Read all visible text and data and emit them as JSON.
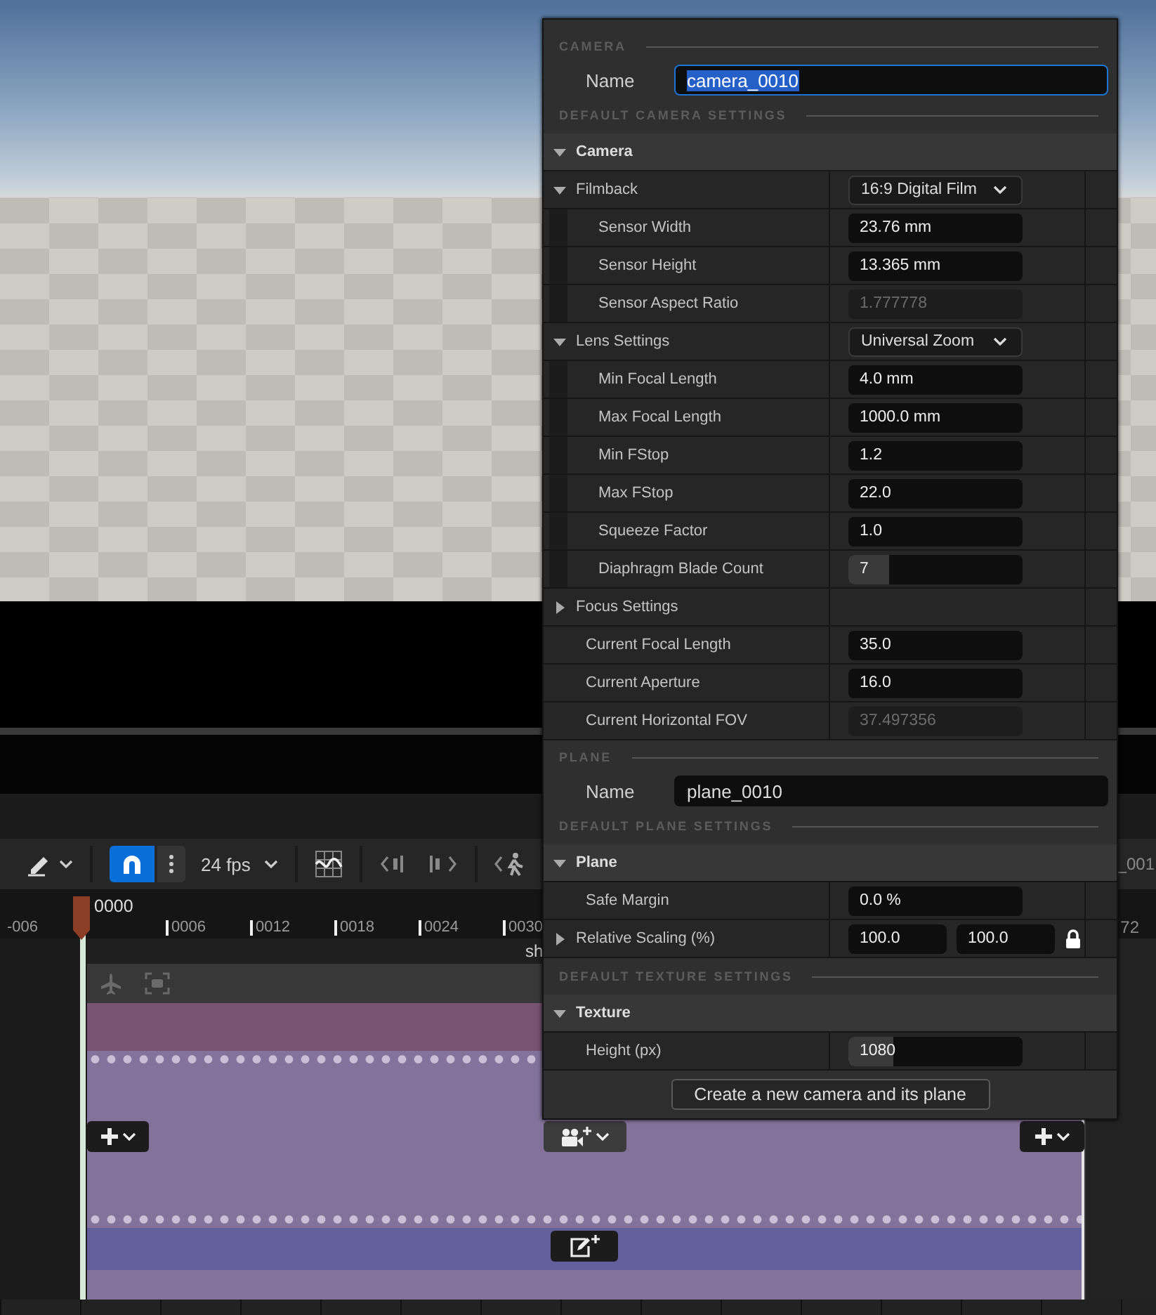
{
  "toolbar": {
    "snap_on": true,
    "frame_rate": "24 fps",
    "cut_label": "_001"
  },
  "ruler": {
    "playhead_time": "0000",
    "ticks": [
      "-006",
      "0006",
      "0012",
      "0018",
      "0024",
      "0030"
    ],
    "cut_label": "72"
  },
  "track": {
    "cut_label": "sh"
  },
  "panel": {
    "groups": [
      {
        "heading": "CAMERA",
        "name_field": {
          "label": "Name",
          "value": "camera_0010",
          "focused": true
        },
        "settings_heading": "DEFAULT CAMERA SETTINGS",
        "category": {
          "title": "Camera",
          "expanded": true,
          "properties": [
            {
              "label": "Filmback",
              "kind": "dropdown",
              "value": "16:9 Digital Film",
              "expanded": true,
              "children": [
                {
                  "label": "Sensor Width",
                  "kind": "number",
                  "value": "23.76 mm"
                },
                {
                  "label": "Sensor Height",
                  "kind": "number",
                  "value": "13.365 mm"
                },
                {
                  "label": "Sensor Aspect Ratio",
                  "kind": "readonly",
                  "value": "1.777778"
                }
              ]
            },
            {
              "label": "Lens Settings",
              "kind": "dropdown",
              "value": "Universal Zoom",
              "expanded": true,
              "children": [
                {
                  "label": "Min Focal Length",
                  "kind": "number",
                  "value": "4.0 mm"
                },
                {
                  "label": "Max Focal Length",
                  "kind": "number",
                  "value": "1000.0 mm"
                },
                {
                  "label": "Min FStop",
                  "kind": "number",
                  "value": "1.2"
                },
                {
                  "label": "Max FStop",
                  "kind": "number",
                  "value": "22.0"
                },
                {
                  "label": "Squeeze Factor",
                  "kind": "number",
                  "value": "1.0"
                },
                {
                  "label": "Diaphragm Blade Count",
                  "kind": "spin",
                  "value": "7",
                  "level": 0.23
                }
              ]
            },
            {
              "label": "Focus Settings",
              "kind": "group",
              "expanded": false
            },
            {
              "label": "Current Focal Length",
              "kind": "number",
              "value": "35.0"
            },
            {
              "label": "Current Aperture",
              "kind": "number",
              "value": "16.0"
            },
            {
              "label": "Current Horizontal FOV",
              "kind": "readonly",
              "value": "37.497356"
            }
          ]
        }
      },
      {
        "heading": "PLANE",
        "name_field": {
          "label": "Name",
          "value": "plane_0010",
          "focused": false
        },
        "settings_heading": "DEFAULT PLANE SETTINGS",
        "category": {
          "title": "Plane",
          "expanded": true,
          "properties": [
            {
              "label": "Safe Margin",
              "kind": "number",
              "value": "0.0 %"
            },
            {
              "label": "Relative Scaling (%)",
              "kind": "vector",
              "values": [
                "100.0",
                "100.0"
              ],
              "locked": true,
              "expanded": false
            }
          ]
        }
      },
      {
        "settings_heading": "DEFAULT TEXTURE SETTINGS",
        "category": {
          "title": "Texture",
          "expanded": true,
          "properties": [
            {
              "label": "Height (px)",
              "kind": "spin",
              "value": "1080",
              "level": 0.26
            }
          ]
        }
      }
    ],
    "button": "Create a new camera and its plane"
  }
}
